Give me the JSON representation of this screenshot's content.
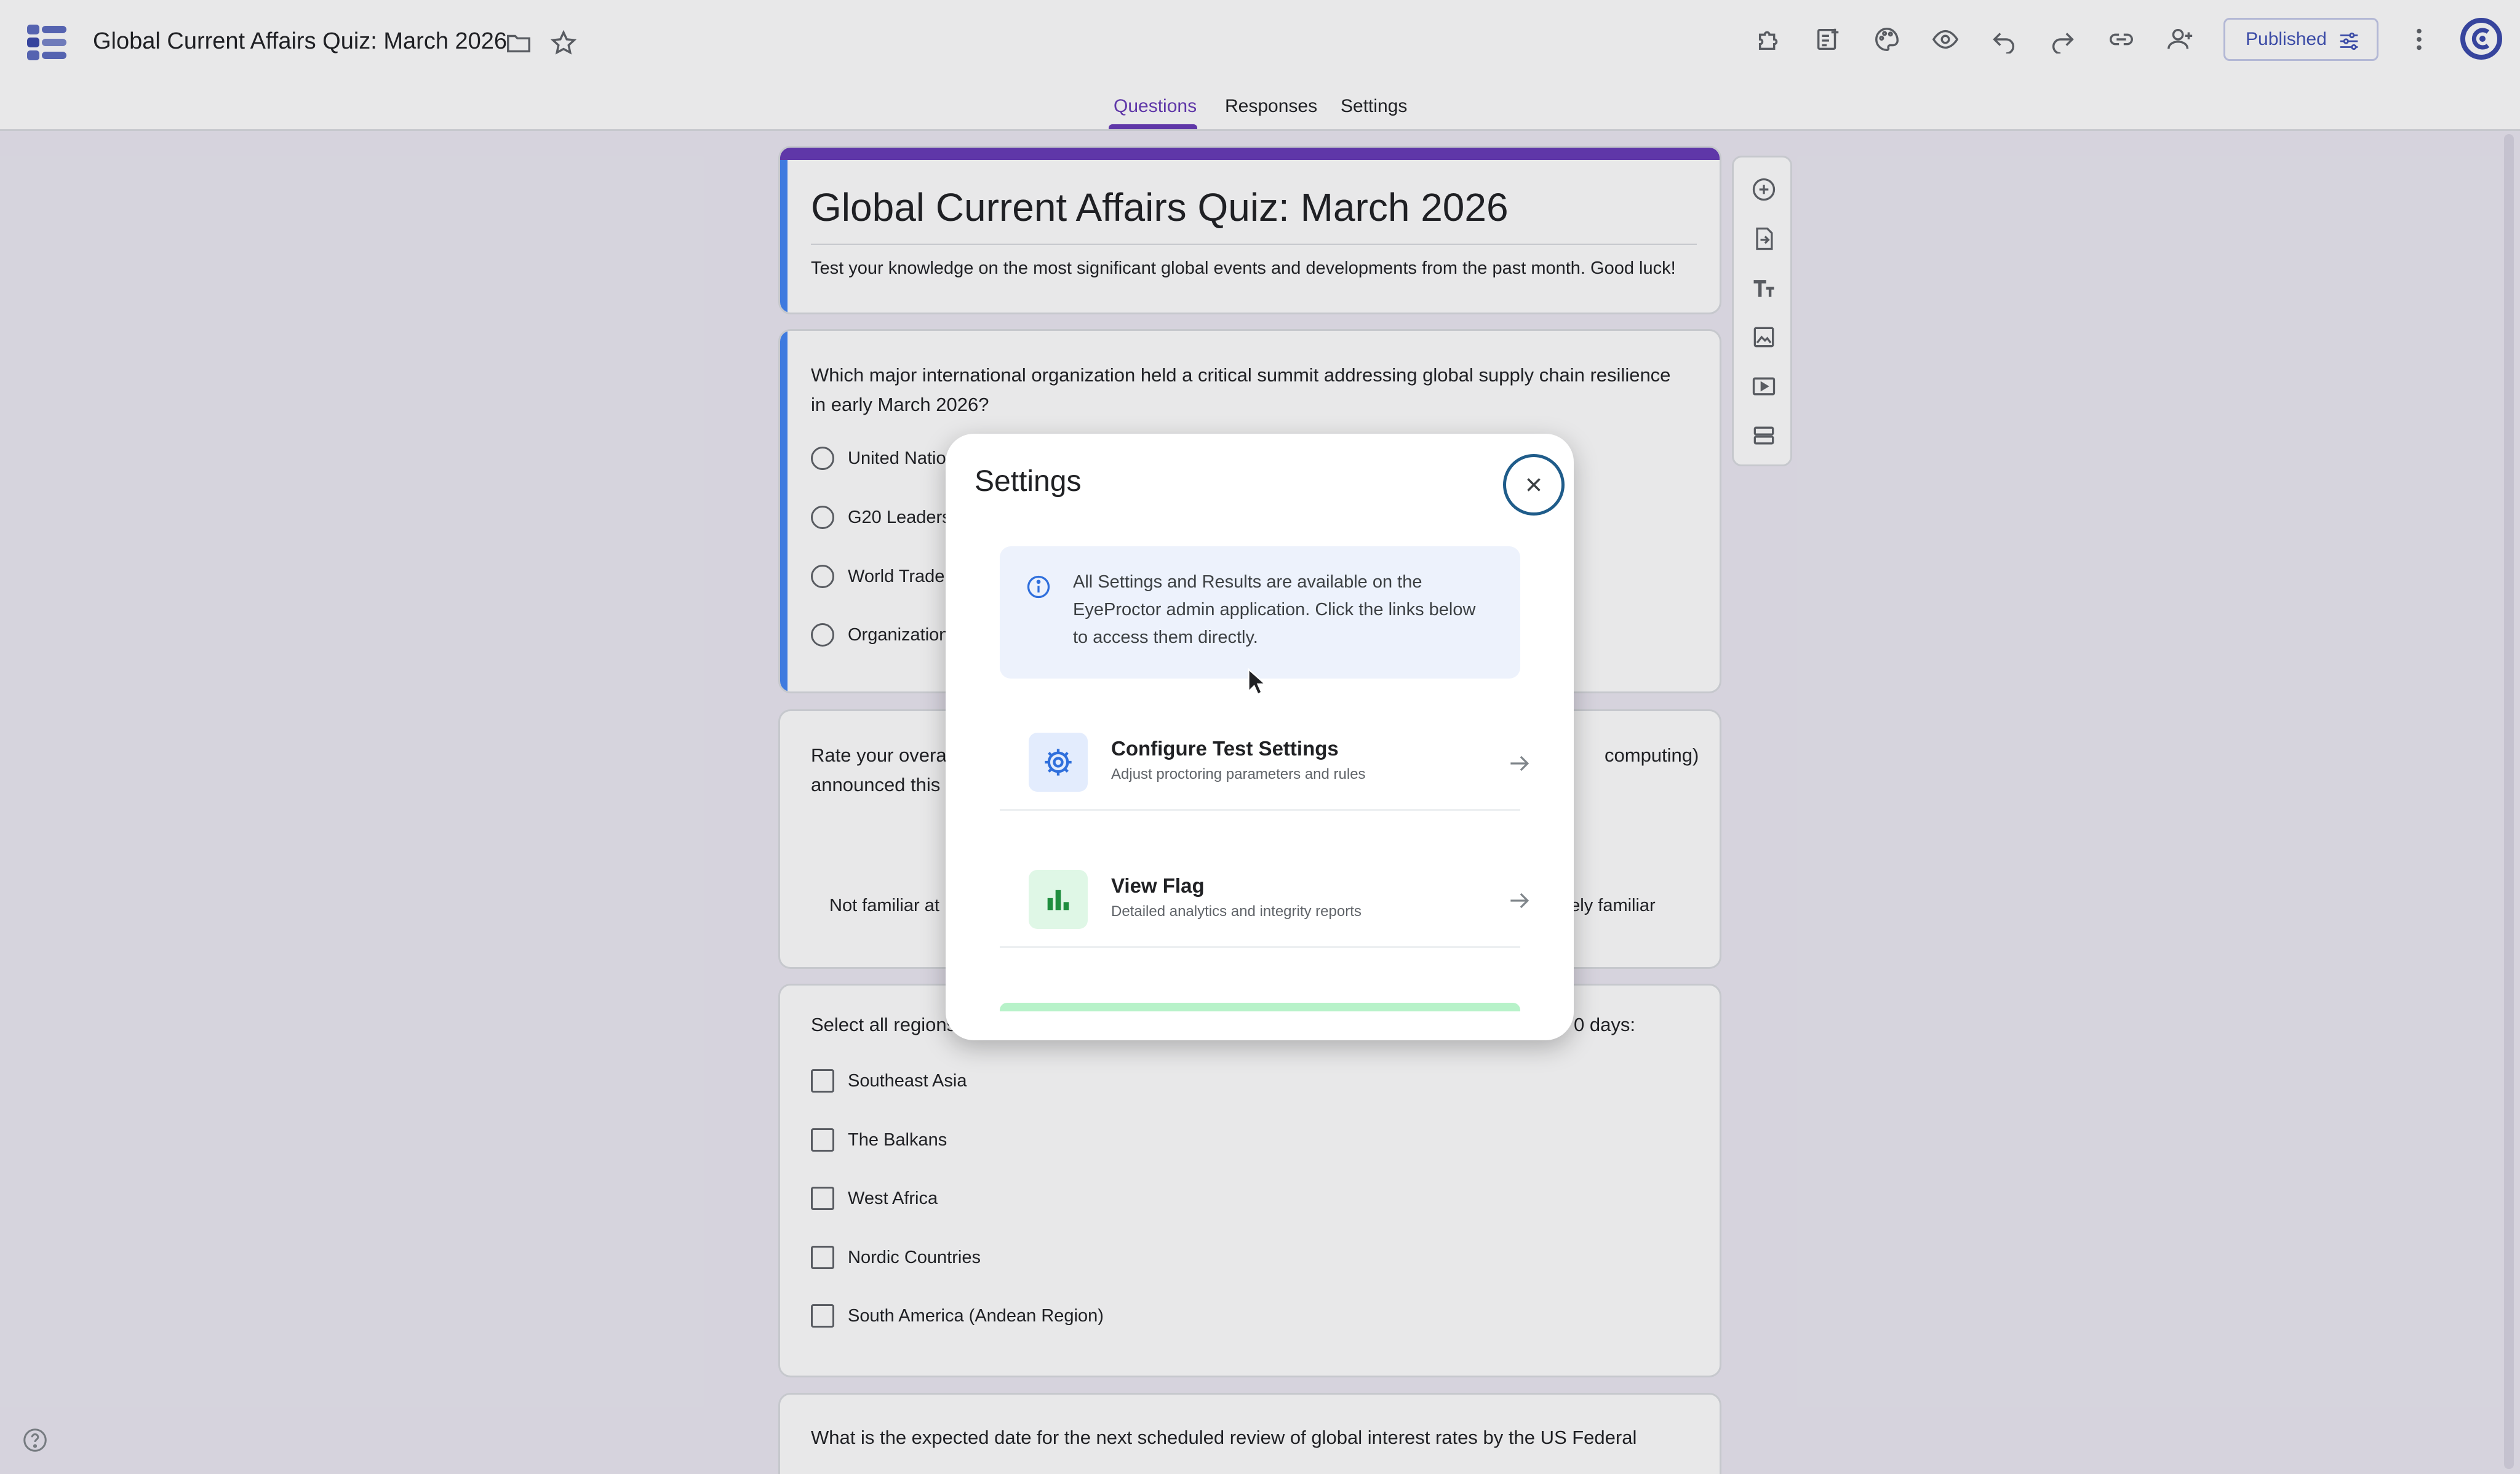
{
  "header": {
    "doc_title": "Global Current Affairs Quiz: March 2026",
    "published_label": "Published",
    "tabs": [
      "Questions",
      "Responses",
      "Settings"
    ]
  },
  "form": {
    "title": "Global Current Affairs Quiz: March 2026",
    "description": "Test your knowledge on the most significant global events and developments from the past month. Good luck!",
    "q1": {
      "text": "Which major international organization held a critical summit addressing global supply chain resilience in early March 2026?",
      "options": [
        "United Natio",
        "G20 Leaders",
        "World Trade",
        "Organization"
      ]
    },
    "q2": {
      "text_left": "Rate your overal",
      "text_right": "computing)",
      "text_line2": "announced this",
      "scale_low": "Not familiar at",
      "scale_high": "nely familiar"
    },
    "q3": {
      "text_left": "Select all regions",
      "text_right": "0 days:",
      "options": [
        "Southeast Asia",
        "The Balkans",
        "West Africa",
        "Nordic Countries",
        "South America (Andean Region)"
      ]
    },
    "q4": {
      "text": "What is the expected date for the next scheduled review of global interest rates by the US Federal"
    }
  },
  "modal": {
    "title": "Settings",
    "info_text": "All Settings and Results are available on the EyeProctor admin application. Click the links below to access them directly.",
    "links": [
      {
        "title": "Configure Test Settings",
        "subtitle": "Adjust proctoring parameters and rules",
        "icon": "gear-icon",
        "badge_color": "#e3ecfd",
        "icon_color": "#2f6fdc"
      },
      {
        "title": "View Flag",
        "subtitle": "Detailed analytics and integrity reports",
        "icon": "bar-chart-icon",
        "badge_color": "#dff7e6",
        "icon_color": "#1e8e3e"
      }
    ]
  },
  "colors": {
    "accent": "#673ab7",
    "question_bar": "#4285f4",
    "close_ring": "#1f5c8a"
  }
}
